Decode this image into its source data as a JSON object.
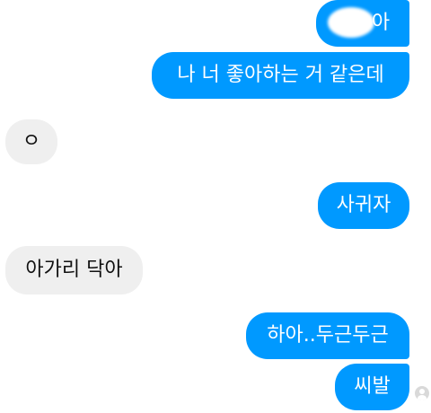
{
  "colors": {
    "sent_bubble": "#0099ff",
    "received_bubble": "#efefef",
    "sent_text": "#ffffff",
    "received_text": "#111111"
  },
  "messages": [
    {
      "side": "sent",
      "text": "아",
      "note_redacted_name": true
    },
    {
      "side": "sent",
      "text": "나 너 좋아하는 거 같은데"
    },
    {
      "side": "received",
      "text": "ㅇ"
    },
    {
      "side": "sent",
      "text": "사귀자"
    },
    {
      "side": "received",
      "text": "아가리 닥아"
    },
    {
      "side": "sent",
      "text": "하아..두근두근"
    },
    {
      "side": "sent",
      "text": "씨발"
    }
  ],
  "icons": {
    "seen": "seen-avatar-icon"
  }
}
